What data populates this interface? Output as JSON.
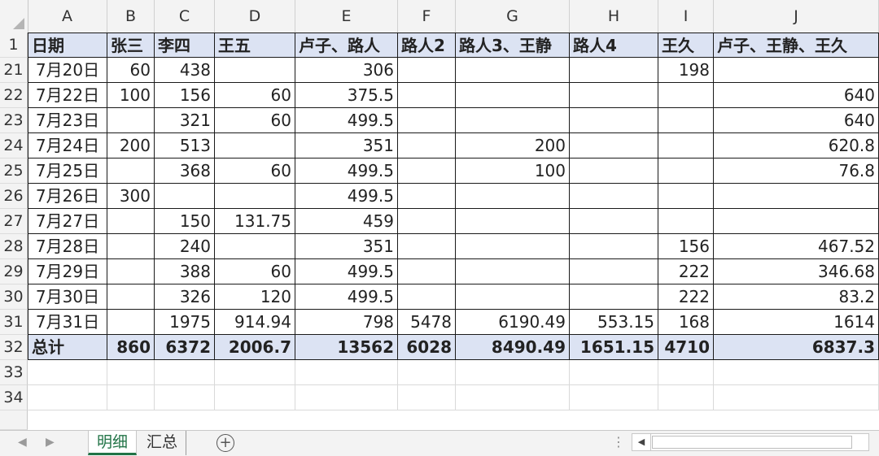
{
  "columns": [
    "A",
    "B",
    "C",
    "D",
    "E",
    "F",
    "G",
    "H",
    "I",
    "J"
  ],
  "header_row": {
    "row_num": "1",
    "cells": [
      "日期",
      "张三",
      "李四",
      "王五",
      "卢子、路人",
      "路人2",
      "路人3、王静",
      "路人4",
      "王久",
      "卢子、王静、王久"
    ]
  },
  "rows": [
    {
      "row_num": "21",
      "cells": [
        "7月20日",
        "60",
        "438",
        "",
        "306",
        "",
        "",
        "",
        "198",
        ""
      ]
    },
    {
      "row_num": "22",
      "cells": [
        "7月22日",
        "100",
        "156",
        "60",
        "375.5",
        "",
        "",
        "",
        "",
        "640"
      ]
    },
    {
      "row_num": "23",
      "cells": [
        "7月23日",
        "",
        "321",
        "60",
        "499.5",
        "",
        "",
        "",
        "",
        "640"
      ]
    },
    {
      "row_num": "24",
      "cells": [
        "7月24日",
        "200",
        "513",
        "",
        "351",
        "",
        "200",
        "",
        "",
        "620.8"
      ]
    },
    {
      "row_num": "25",
      "cells": [
        "7月25日",
        "",
        "368",
        "60",
        "499.5",
        "",
        "100",
        "",
        "",
        "76.8"
      ]
    },
    {
      "row_num": "26",
      "cells": [
        "7月26日",
        "300",
        "",
        "",
        "499.5",
        "",
        "",
        "",
        "",
        ""
      ]
    },
    {
      "row_num": "27",
      "cells": [
        "7月27日",
        "",
        "150",
        "131.75",
        "459",
        "",
        "",
        "",
        "",
        ""
      ]
    },
    {
      "row_num": "28",
      "cells": [
        "7月28日",
        "",
        "240",
        "",
        "351",
        "",
        "",
        "",
        "156",
        "467.52"
      ]
    },
    {
      "row_num": "29",
      "cells": [
        "7月29日",
        "",
        "388",
        "60",
        "499.5",
        "",
        "",
        "",
        "222",
        "346.68"
      ]
    },
    {
      "row_num": "30",
      "cells": [
        "7月30日",
        "",
        "326",
        "120",
        "499.5",
        "",
        "",
        "",
        "222",
        "83.2"
      ]
    },
    {
      "row_num": "31",
      "cells": [
        "7月31日",
        "",
        "1975",
        "914.94",
        "798",
        "5478",
        "6190.49",
        "553.15",
        "168",
        "1614"
      ]
    }
  ],
  "total_row": {
    "row_num": "32",
    "cells": [
      "总计",
      "860",
      "6372",
      "2006.7",
      "13562",
      "6028",
      "8490.49",
      "1651.15",
      "4710",
      "6837.3"
    ]
  },
  "empty_rows": [
    "33",
    "34"
  ],
  "sheet_tabs": [
    {
      "label": "明细",
      "active": true
    },
    {
      "label": "汇总",
      "active": false
    }
  ],
  "colors": {
    "header_fill": "#dce3f3",
    "active_tab": "#217346"
  }
}
